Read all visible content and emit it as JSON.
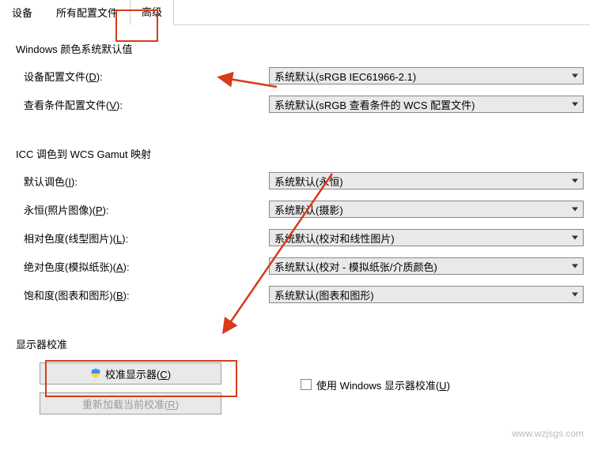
{
  "tabs": {
    "devices": "设备",
    "allProfiles": "所有配置文件",
    "advanced": "高级"
  },
  "section1": {
    "title": "Windows 颜色系统默认值",
    "rows": {
      "deviceProfile": {
        "label": "设备配置文件(",
        "accel": "D",
        "after": "):",
        "value": "系统默认(sRGB IEC61966-2.1)"
      },
      "viewingProfile": {
        "label": "查看条件配置文件(",
        "accel": "V",
        "after": "):",
        "value": "系统默认(sRGB 查看条件的 WCS 配置文件)"
      }
    }
  },
  "section2": {
    "title": "ICC 调色到 WCS Gamut 映射",
    "rows": {
      "defaultTone": {
        "label": "默认调色(",
        "accel": "I",
        "after": "):",
        "value": "系统默认(永恒)"
      },
      "perpetual": {
        "label": "永恒(照片图像)(",
        "accel": "P",
        "after": "):",
        "value": "系统默认(摄影)"
      },
      "relative": {
        "label": "相对色度(线型图片)(",
        "accel": "L",
        "after": "):",
        "value": "系统默认(校对和线性图片)"
      },
      "absolute": {
        "label": "绝对色度(模拟纸张)(",
        "accel": "A",
        "after": "):",
        "value": "系统默认(校对 - 模拟纸张/介质颜色)"
      },
      "saturation": {
        "label": "饱和度(图表和图形)(",
        "accel": "B",
        "after": "):",
        "value": "系统默认(图表和图形)"
      }
    }
  },
  "section3": {
    "title": "显示器校准",
    "calibrateBtn": {
      "label": "校准显示器(",
      "accel": "C",
      "after": ")"
    },
    "reloadBtn": {
      "label": "重新加载当前校准(",
      "accel": "R",
      "after": ")"
    },
    "useWindows": {
      "label": "使用 Windows 显示器校准(",
      "accel": "U",
      "after": ")"
    }
  },
  "watermark": "www.wzjsgs.com"
}
